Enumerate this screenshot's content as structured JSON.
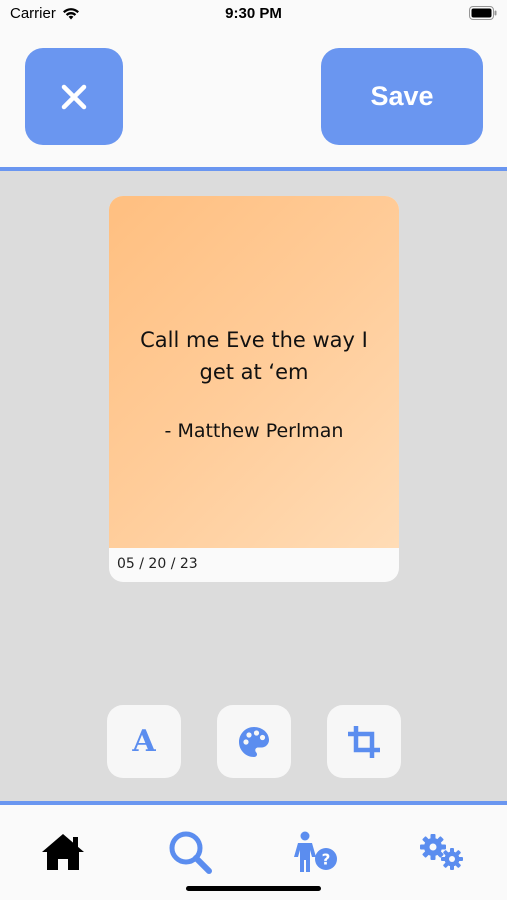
{
  "status_bar": {
    "carrier": "Carrier",
    "time": "9:30 PM",
    "icons": [
      "wifi-icon",
      "battery-icon"
    ]
  },
  "header": {
    "close_icon": "close-icon",
    "save_label": "Save"
  },
  "card": {
    "quote": "Call me Eve the way I get at ‘em",
    "author": "- Matthew Perlman",
    "date": "05 / 20 / 23",
    "gradient_colors": [
      "#ffbf80",
      "#ffdcb6"
    ]
  },
  "tools": [
    {
      "name": "font",
      "icon": "font-icon",
      "glyph": "A"
    },
    {
      "name": "palette",
      "icon": "palette-icon"
    },
    {
      "name": "crop",
      "icon": "crop-icon"
    }
  ],
  "nav": [
    {
      "name": "home",
      "icon": "home-icon",
      "active": true
    },
    {
      "name": "search",
      "icon": "search-icon",
      "active": false
    },
    {
      "name": "help",
      "icon": "person-help-icon",
      "active": false
    },
    {
      "name": "settings",
      "icon": "gears-icon",
      "active": false
    }
  ],
  "colors": {
    "accent": "#6a96f0",
    "icon_blue": "#5b8def",
    "background": "#dcdcdc",
    "active_nav": "#000000"
  }
}
